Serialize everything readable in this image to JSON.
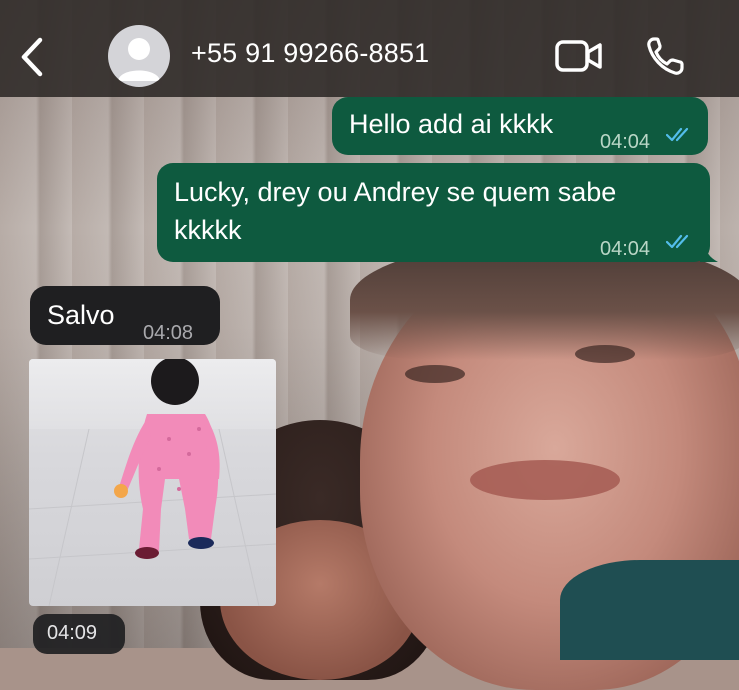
{
  "header": {
    "back_icon": "chevron-left-icon",
    "contact_name": "+55 91 99266-8851",
    "avatar_icon": "person-silhouette-icon",
    "video_icon": "video-camera-icon",
    "call_icon": "phone-icon"
  },
  "messages": [
    {
      "direction": "outgoing",
      "text": "Hello add ai kkkk",
      "time": "04:04",
      "status": "read"
    },
    {
      "direction": "outgoing",
      "text_line1": "Lucky, drey ou Andrey se quem sabe",
      "text_line2": "kkkkk",
      "time": "04:04",
      "status": "read"
    },
    {
      "direction": "incoming",
      "text": "Salvo",
      "time": "04:08"
    },
    {
      "direction": "incoming",
      "type": "image",
      "time": "04:09"
    }
  ],
  "colors": {
    "outgoing_bubble": "#0e5a3f",
    "incoming_bubble": "#1f1f21",
    "read_ticks": "#53bdeb",
    "header_bg": "#2c2826"
  }
}
